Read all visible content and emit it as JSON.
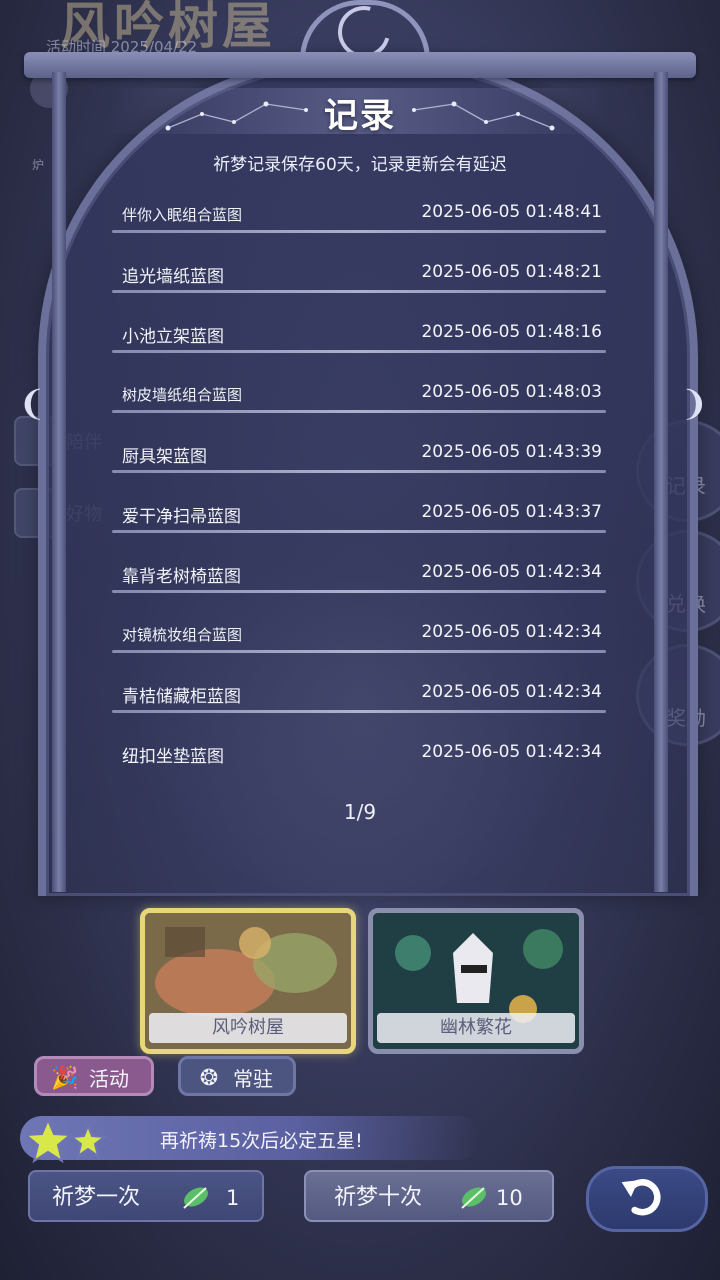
{
  "background": {
    "banner_title": "风吟树屋",
    "activity_time": "活动时间 2025/04/22",
    "side_label": "炉",
    "left_items": [
      "陪伴",
      "好物"
    ],
    "right_items": [
      "记录",
      "兑换",
      "奖励"
    ]
  },
  "panel": {
    "title": "记录",
    "subtitle": "祈梦记录保存60天，记录更新会有延迟",
    "records": [
      {
        "name": "伴你入眠组合蓝图",
        "time": "2025-06-05 01:48:41"
      },
      {
        "name": "追光墙纸蓝图",
        "time": "2025-06-05 01:48:21"
      },
      {
        "name": "小池立架蓝图",
        "time": "2025-06-05 01:48:16"
      },
      {
        "name": "树皮墙纸组合蓝图",
        "time": "2025-06-05 01:48:03"
      },
      {
        "name": "厨具架蓝图",
        "time": "2025-06-05 01:43:39"
      },
      {
        "name": "爱干净扫帚蓝图",
        "time": "2025-06-05 01:43:37"
      },
      {
        "name": "靠背老树椅蓝图",
        "time": "2025-06-05 01:42:34"
      },
      {
        "name": "对镜梳妆组合蓝图",
        "time": "2025-06-05 01:42:34"
      },
      {
        "name": "青桔储藏柜蓝图",
        "time": "2025-06-05 01:42:34"
      },
      {
        "name": "纽扣坐垫蓝图",
        "time": "2025-06-05 01:42:34"
      }
    ],
    "pager": "1/9",
    "prev_arrow": "❨",
    "next_arrow": "❩"
  },
  "banners": [
    {
      "label": "风吟树屋"
    },
    {
      "label": "幽林繁花"
    }
  ],
  "tabs": {
    "activity": "活动",
    "permanent": "常驻"
  },
  "pity": {
    "text": "再祈祷15次后必定五星!"
  },
  "draw": {
    "once_label": "祈梦一次",
    "once_cost": "1",
    "ten_label": "祈梦十次",
    "ten_cost": "10"
  },
  "colors": {
    "accent_gold": "#e8d67b",
    "panel_frame": "#6b709a",
    "activity_tab": "#8a5a8e"
  }
}
